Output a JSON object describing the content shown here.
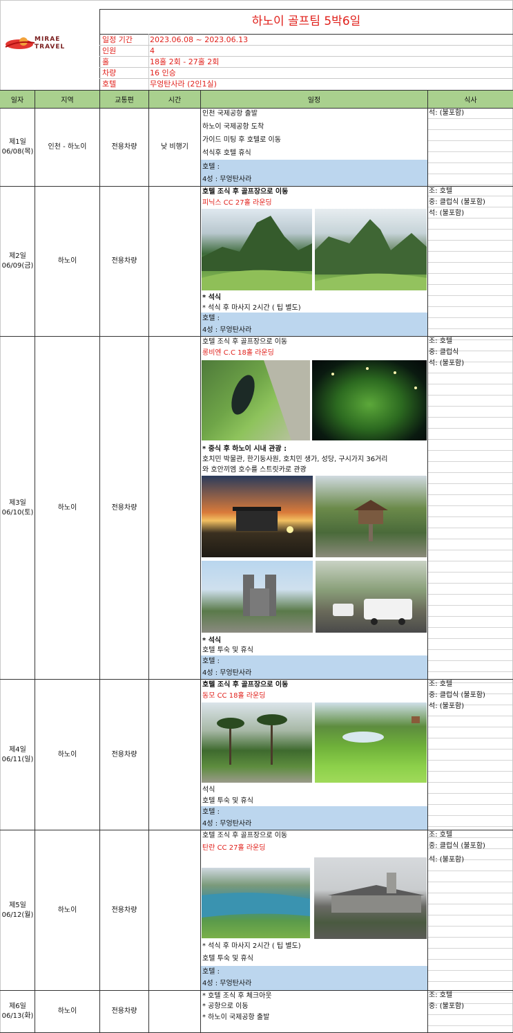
{
  "logo": {
    "line1": "MIRAE",
    "line2": "TRAVEL"
  },
  "title": "하노이 골프팀 5박6일",
  "info": [
    {
      "label": "일정 기간",
      "value": "2023.06.08 ~ 2023.06.13"
    },
    {
      "label": "인원",
      "value": "4"
    },
    {
      "label": "홀",
      "value": "18홀 2회  -  27홀 2회"
    },
    {
      "label": "차량",
      "value": "16 인승"
    },
    {
      "label": "호텔",
      "value": "무엉탄사라  (2인1실)"
    }
  ],
  "headers": {
    "day": "일자",
    "region": "지역",
    "transport": "교통편",
    "time": "시간",
    "schedule": "일정",
    "meal": "식사"
  },
  "days": [
    {
      "day": "제1일",
      "date": "06/08(목)",
      "region": "인천 - 하노이",
      "transport": "전용차량",
      "time": "낮 비행기",
      "lines": [
        "인천 국제공항 출발",
        "하노이 국제공항 도착",
        "가이드 미팅 후 호텔로 이동",
        "석식후 호텔 휴식"
      ],
      "hotel_label": "호텔 :",
      "hotel": "4성 : 무엉탄사라",
      "meals": [
        "석: (불포함)"
      ]
    },
    {
      "day": "제2일",
      "date": "06/09(금)",
      "region": "하노이",
      "transport": "전용차량",
      "lines": [
        "호텔 조식 후 골프장으로 이동",
        "피닉스 CC  27홀 라운딩",
        "* 석식",
        "* 석식 후 마사지 2시간 ( 팁 별도)"
      ],
      "hotel_label": "호텔 :",
      "hotel": "4성 : 무엉탄사라",
      "meals": [
        "조: 호텔",
        "중: 클럽식 (불포함)",
        "석: (불포함)"
      ]
    },
    {
      "day": "제3일",
      "date": "06/10(토)",
      "region": "하노이",
      "transport": "전용차량",
      "lines": [
        "호텔 조식 후 골프장으로 이동",
        "롱비엔 C.C 18홀 라운딩",
        "* 중식 후 하노이 시내 관광 :",
        "호치민 박물관, 한기둥사원, 호치민 생가, 성당, 구시가지 36거리",
        "와 호안끼엠 호수를 스트릿카로 관광",
        "* 석식",
        "호텔 투숙 및 휴식"
      ],
      "hotel_label": "호텔 :",
      "hotel": "4성 : 무엉탄사라",
      "meals": [
        "조: 호텔",
        "중: 클럽식",
        "석: (불포함)"
      ]
    },
    {
      "day": "제4일",
      "date": "06/11(일)",
      "region": "하노이",
      "transport": "전용차량",
      "lines": [
        "호텔 조식 후 골프장으로 이동",
        "동모 CC  18홀 라운딩",
        "석식",
        "호텔 투숙 및 휴식"
      ],
      "hotel_label": "호텔 :",
      "hotel": "4성 : 무엉탄사라",
      "meals": [
        "조: 호텔",
        "중: 클럽식 (불포함)",
        "석: (불포함)"
      ]
    },
    {
      "day": "제5일",
      "date": "06/12(월)",
      "region": "하노이",
      "transport": "전용차량",
      "lines": [
        "호텔 조식 후 골프장으로 이동",
        "탄란 CC  27홀 라운딩",
        "* 석식 후 마사지 2시간 ( 팁 별도)",
        "호텔 투숙 및 휴식"
      ],
      "hotel_label": "호텔 :",
      "hotel": "4성 : 무엉탄사라",
      "meals": [
        "조: 호텔",
        "중: 클럽식 (불포함)",
        "석:  (불포함)"
      ]
    },
    {
      "day": "제6일",
      "date": "06/13(화)",
      "region": "하노이",
      "transport": "전용차량",
      "lines": [
        "* 호텔 조식 후 체크아웃",
        "* 공항으로 이동",
        "* 하노이 국제공항 출발"
      ],
      "meals": [
        "조: 호텔",
        "중:  (불포함)"
      ]
    }
  ],
  "colors": {
    "header_green": "#a9d08e",
    "hotel_blue": "#bcd6ee",
    "accent_red": "#e0201b"
  }
}
